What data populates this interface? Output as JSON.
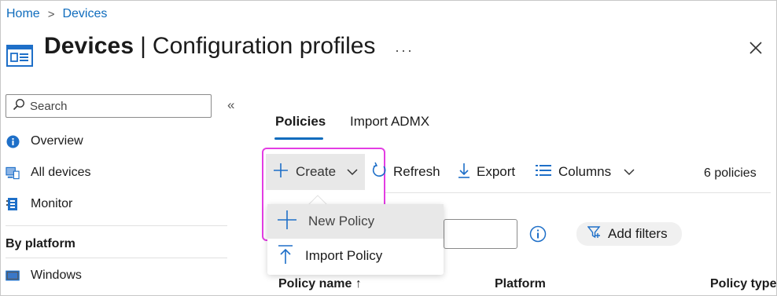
{
  "breadcrumb": {
    "home": "Home",
    "separator": ">",
    "devices": "Devices"
  },
  "header": {
    "title_bold": "Devices",
    "title_sep": "|",
    "title_rest": "Configuration profiles",
    "more": "···",
    "close_icon": "close-icon",
    "page_icon": "configuration-profiles-icon"
  },
  "sidebar": {
    "search_placeholder": "Search",
    "collapse": "«",
    "items": [
      {
        "label": "Overview",
        "icon": "info-icon"
      },
      {
        "label": "All devices",
        "icon": "devices-icon"
      },
      {
        "label": "Monitor",
        "icon": "monitor-icon"
      }
    ],
    "section_label": "By platform",
    "platform_items": [
      {
        "label": "Windows",
        "icon": "windows-icon"
      }
    ]
  },
  "tabs": [
    {
      "label": "Policies",
      "active": true
    },
    {
      "label": "Import ADMX",
      "active": false
    }
  ],
  "toolbar": {
    "create": "Create",
    "refresh": "Refresh",
    "export": "Export",
    "columns": "Columns",
    "count": "6 policies"
  },
  "create_menu": {
    "items": [
      {
        "label": "New Policy",
        "icon": "plus-icon"
      },
      {
        "label": "Import Policy",
        "icon": "upload-icon"
      }
    ]
  },
  "filters": {
    "add_filters": "Add filters",
    "info_icon": "info-circle-icon"
  },
  "table": {
    "columns": [
      "Policy name ↑",
      "Platform",
      "Policy type"
    ]
  },
  "colors": {
    "accent": "#0f6cbd",
    "highlight": "#e33de3"
  }
}
